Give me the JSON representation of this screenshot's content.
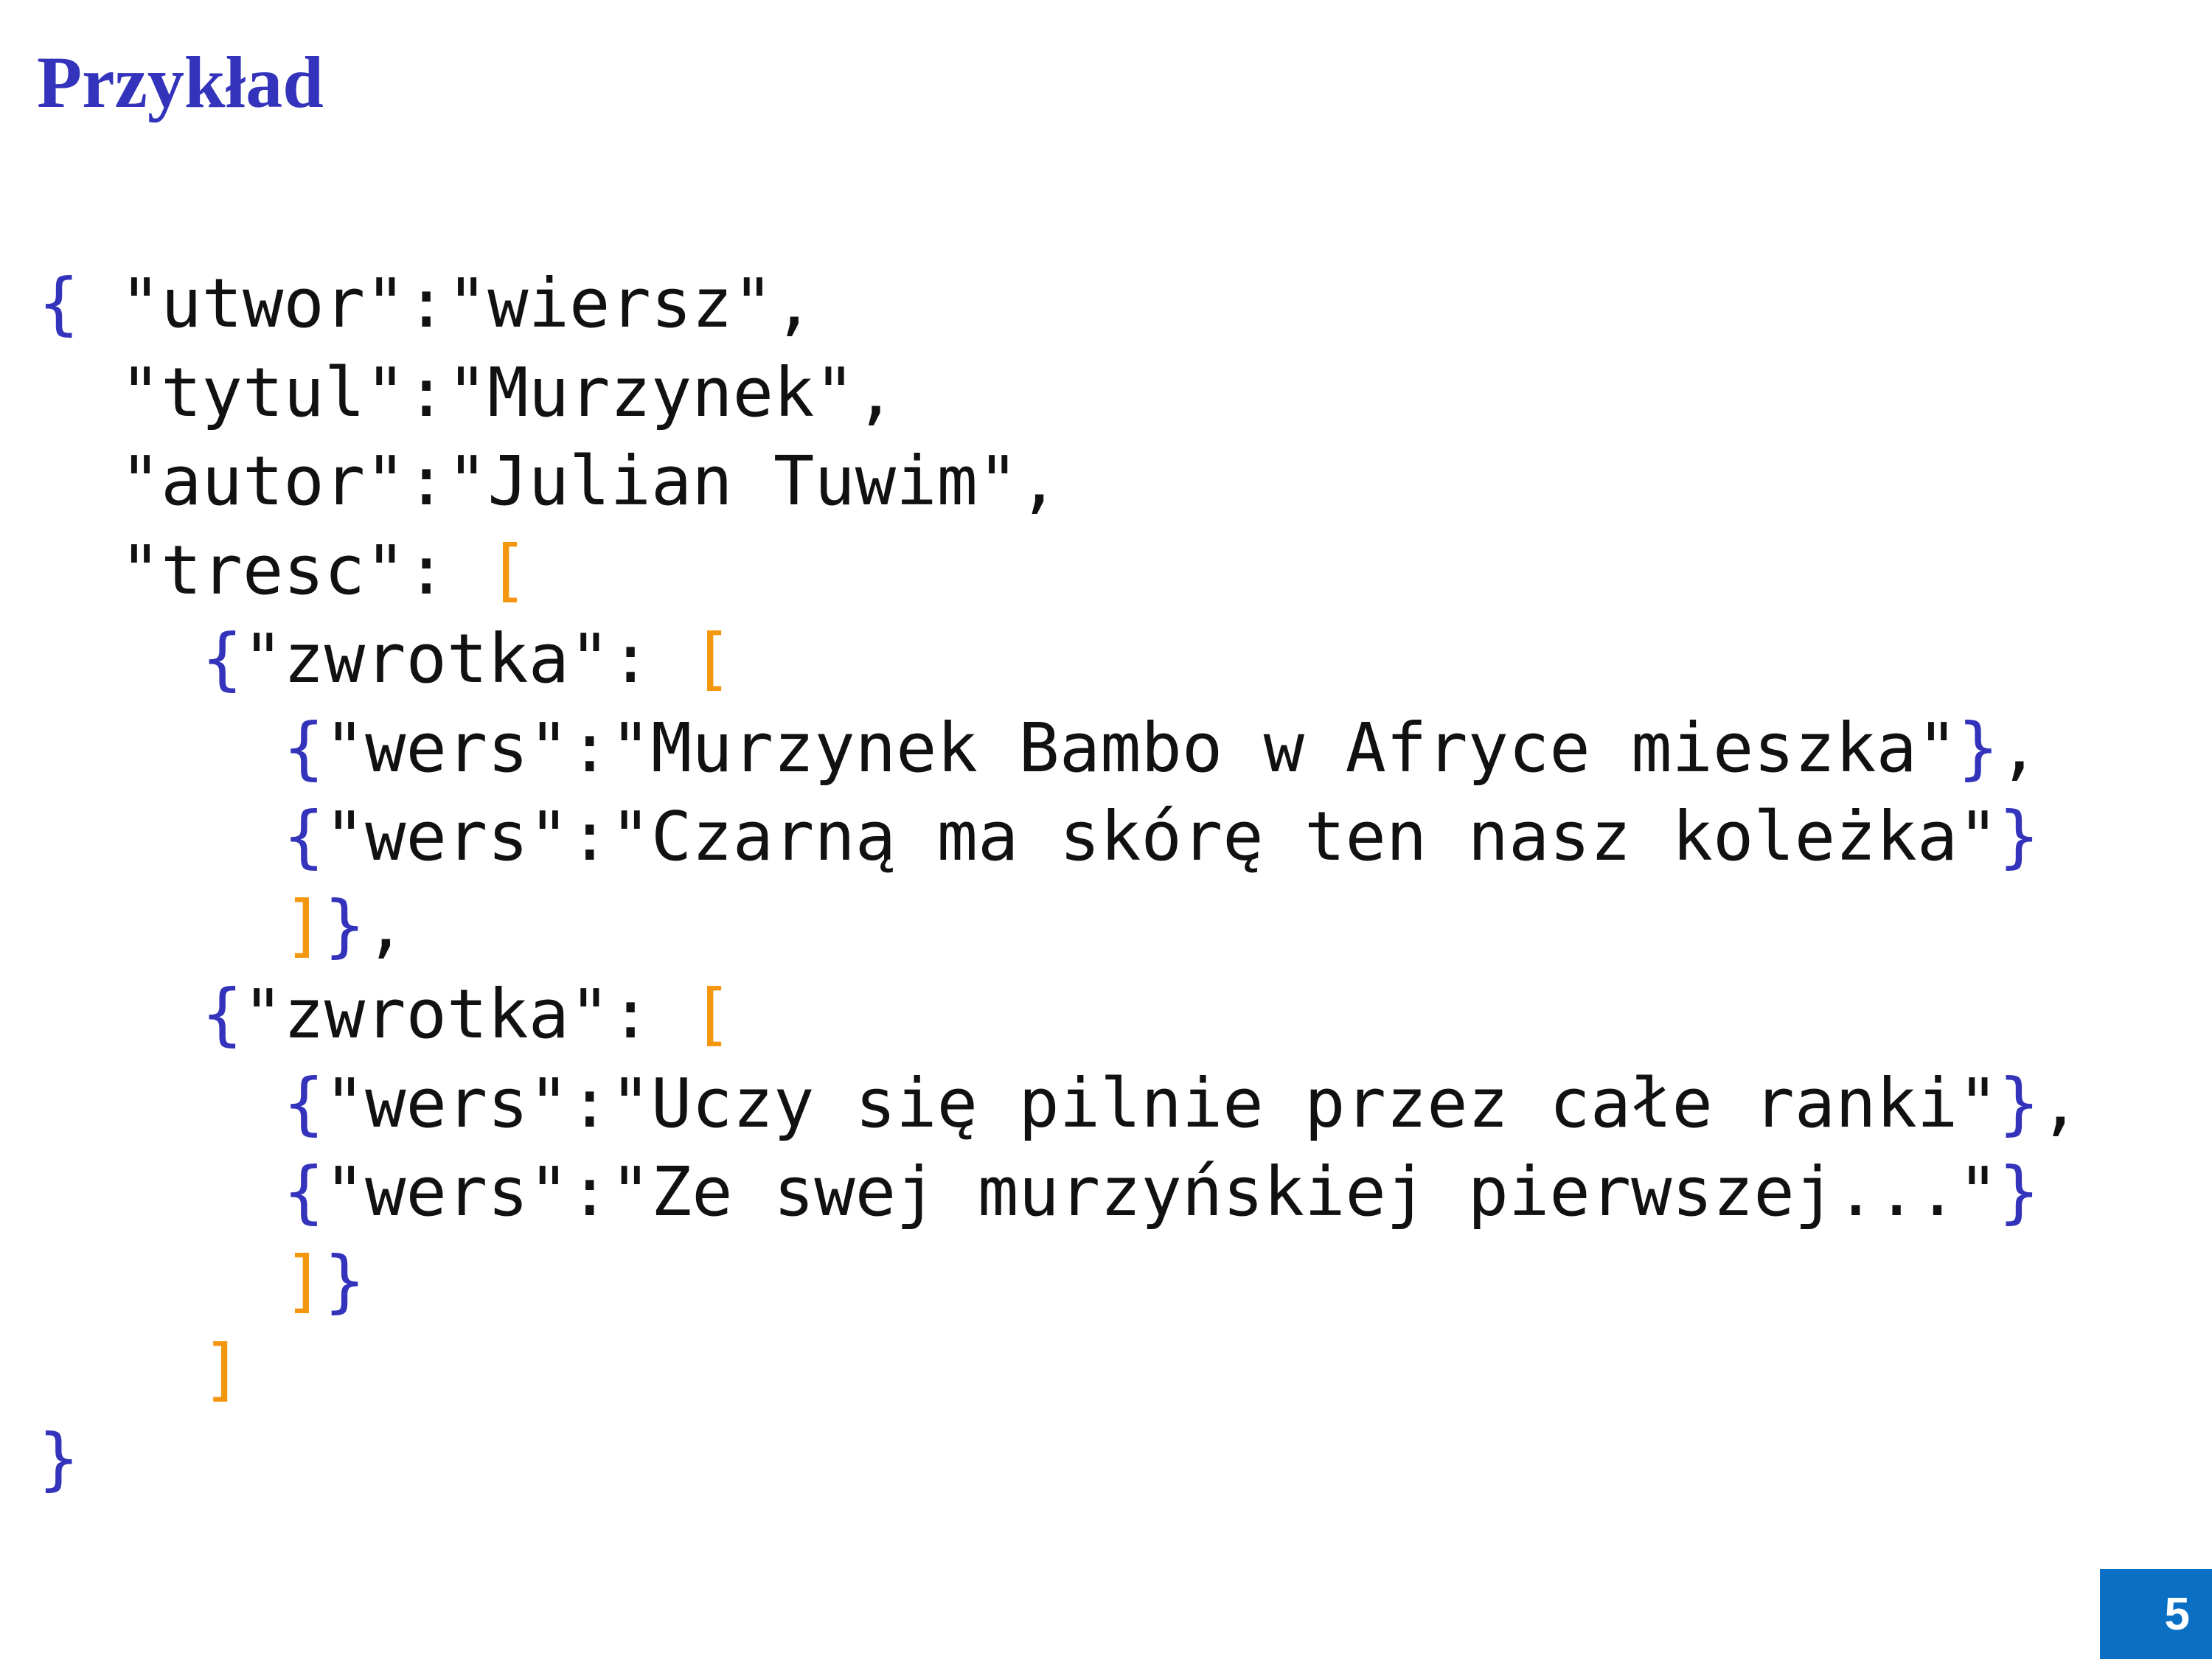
{
  "slide": {
    "title": "Przykład",
    "page_number": "5"
  },
  "code": {
    "lines": [
      [
        {
          "t": "brace",
          "v": "{"
        },
        {
          "t": "text",
          "v": " \"utwor\":\"wiersz\","
        }
      ],
      [
        {
          "t": "text",
          "v": "  \"tytul\":\"Murzynek\","
        }
      ],
      [
        {
          "t": "text",
          "v": "  \"autor\":\"Julian Tuwim\","
        }
      ],
      [
        {
          "t": "text",
          "v": "  \"tresc\": "
        },
        {
          "t": "bracket",
          "v": "["
        }
      ],
      [
        {
          "t": "text",
          "v": "    "
        },
        {
          "t": "brace",
          "v": "{"
        },
        {
          "t": "text",
          "v": "\"zwrotka\": "
        },
        {
          "t": "bracket",
          "v": "["
        }
      ],
      [
        {
          "t": "text",
          "v": "      "
        },
        {
          "t": "brace",
          "v": "{"
        },
        {
          "t": "text",
          "v": "\"wers\":\"Murzynek Bambo w Afryce mieszka\""
        },
        {
          "t": "brace",
          "v": "}"
        },
        {
          "t": "text",
          "v": ","
        }
      ],
      [
        {
          "t": "text",
          "v": "      "
        },
        {
          "t": "brace",
          "v": "{"
        },
        {
          "t": "text",
          "v": "\"wers\":\"Czarną ma skórę ten nasz koleżka\""
        },
        {
          "t": "brace",
          "v": "}"
        }
      ],
      [
        {
          "t": "text",
          "v": "      "
        },
        {
          "t": "bracket",
          "v": "]"
        },
        {
          "t": "brace",
          "v": "}"
        },
        {
          "t": "text",
          "v": ","
        }
      ],
      [
        {
          "t": "text",
          "v": "    "
        },
        {
          "t": "brace",
          "v": "{"
        },
        {
          "t": "text",
          "v": "\"zwrotka\": "
        },
        {
          "t": "bracket",
          "v": "["
        }
      ],
      [
        {
          "t": "text",
          "v": "      "
        },
        {
          "t": "brace",
          "v": "{"
        },
        {
          "t": "text",
          "v": "\"wers\":\"Uczy się pilnie przez całe ranki\""
        },
        {
          "t": "brace",
          "v": "}"
        },
        {
          "t": "text",
          "v": ","
        }
      ],
      [
        {
          "t": "text",
          "v": "      "
        },
        {
          "t": "brace",
          "v": "{"
        },
        {
          "t": "text",
          "v": "\"wers\":\"Ze swej murzyńskiej pierwszej...\""
        },
        {
          "t": "brace",
          "v": "}"
        }
      ],
      [
        {
          "t": "text",
          "v": "      "
        },
        {
          "t": "bracket",
          "v": "]"
        },
        {
          "t": "brace",
          "v": "}"
        }
      ],
      [
        {
          "t": "text",
          "v": "    "
        },
        {
          "t": "bracket",
          "v": "]"
        }
      ],
      [
        {
          "t": "brace",
          "v": "}"
        }
      ]
    ]
  },
  "colors": {
    "title": "#3333bb",
    "brace": "#3333bb",
    "bracket": "#f5960f",
    "text": "#111111",
    "page_badge_bg": "#0b6fc4",
    "page_badge_text": "#ffffff"
  }
}
